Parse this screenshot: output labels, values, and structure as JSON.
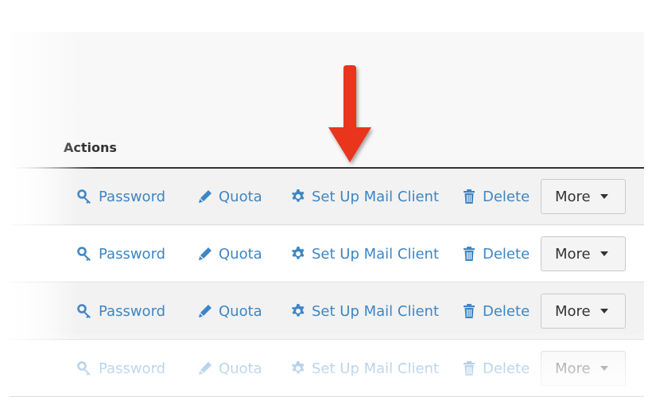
{
  "table": {
    "heading": "Actions",
    "rows": [
      {
        "password": "Password",
        "quota": "Quota",
        "mail_client": "Set Up Mail Client",
        "delete": "Delete",
        "more": "More"
      },
      {
        "password": "Password",
        "quota": "Quota",
        "mail_client": "Set Up Mail Client",
        "delete": "Delete",
        "more": "More"
      },
      {
        "password": "Password",
        "quota": "Quota",
        "mail_client": "Set Up Mail Client",
        "delete": "Delete",
        "more": "More"
      },
      {
        "password": "Password",
        "quota": "Quota",
        "mail_client": "Set Up Mail Client",
        "delete": "Delete",
        "more": "More"
      }
    ]
  },
  "icons": {
    "password": "key-icon",
    "quota": "pencil-icon",
    "mail_client": "gear-icon",
    "delete": "trash-icon",
    "more": "caret-down-icon",
    "annotation": "red-arrow-down"
  },
  "colors": {
    "link": "#3d86c6",
    "annotation_arrow": "#e8341c",
    "button_bg": "#f4f4f4"
  }
}
